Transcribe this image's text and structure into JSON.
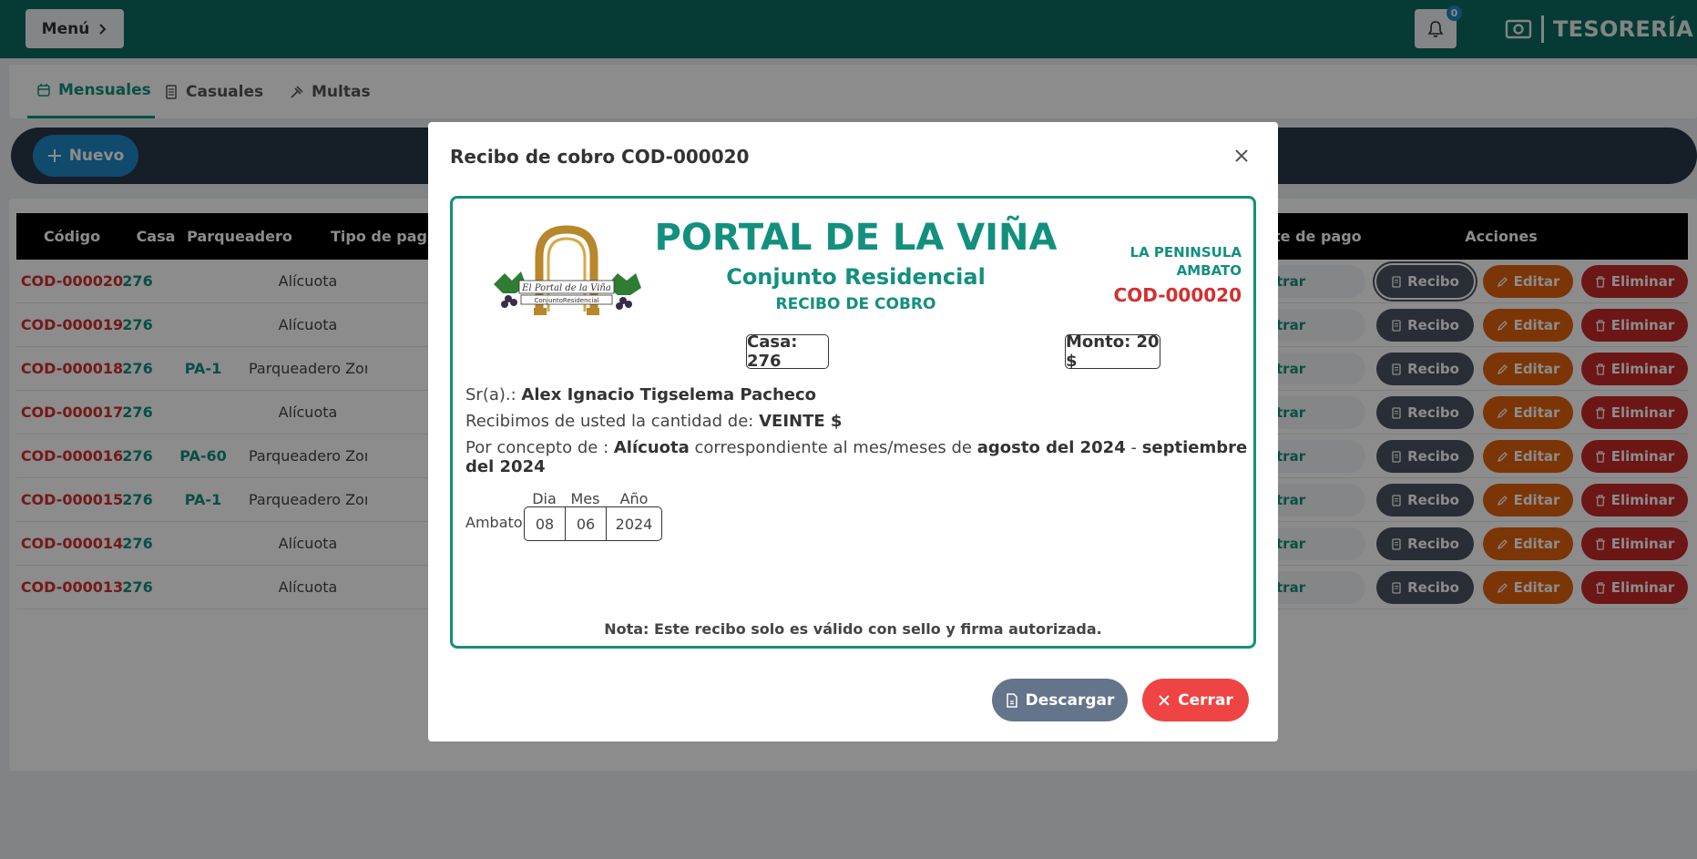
{
  "topbar": {
    "menu_label": "Menú",
    "notification_count": "0",
    "brand": "TESORERÍA"
  },
  "tabs": [
    {
      "label": "Mensuales",
      "icon": "calendar-icon"
    },
    {
      "label": "Casuales",
      "icon": "list-icon"
    },
    {
      "label": "Multas",
      "icon": "gavel-icon"
    }
  ],
  "toolbar": {
    "new_label": "Nuevo"
  },
  "table": {
    "headers": [
      "Código",
      "Casa",
      "Parqueadero",
      "Tipo de pago",
      "te de pago",
      "Acciones"
    ],
    "row_button_registrar": "trar",
    "actions": {
      "recibo": "Recibo",
      "editar": "Editar",
      "eliminar": "Eliminar"
    },
    "rows": [
      {
        "code": "COD-000020",
        "casa": "276",
        "parq": "",
        "tipo": "Alícuota"
      },
      {
        "code": "COD-000019",
        "casa": "276",
        "parq": "",
        "tipo": "Alícuota"
      },
      {
        "code": "COD-000018",
        "casa": "276",
        "parq": "PA-1",
        "tipo": "Parqueadero Zona"
      },
      {
        "code": "COD-000017",
        "casa": "276",
        "parq": "",
        "tipo": "Alícuota"
      },
      {
        "code": "COD-000016",
        "casa": "276",
        "parq": "PA-60",
        "tipo": "Parqueadero Zona"
      },
      {
        "code": "COD-000015",
        "casa": "276",
        "parq": "PA-1",
        "tipo": "Parqueadero Zona"
      },
      {
        "code": "COD-000014",
        "casa": "276",
        "parq": "",
        "tipo": "Alícuota"
      },
      {
        "code": "COD-000013",
        "casa": "276",
        "parq": "",
        "tipo": "Alícuota"
      }
    ]
  },
  "modal": {
    "title": "Recibo de cobro COD-000020",
    "receipt": {
      "logo_text_1": "El Portal de la Viña",
      "logo_text_2": "ConjuntoResidencial",
      "title": "PORTAL DE LA VIÑA",
      "subtitle": "Conjunto Residencial",
      "doc_type": "RECIBO DE COBRO",
      "location_1": "LA PENINSULA",
      "location_2": "AMBATO",
      "code": "COD-000020",
      "casa": "Casa: 276",
      "monto": "Monto: 20 $",
      "sr_label": "Sr(a).:",
      "sr_value": "Alex Ignacio Tigselema Pacheco",
      "amount_label": "Recibimos de usted la cantidad de:",
      "amount_value": "VEINTE $",
      "concept_label": "Por concepto de :",
      "concept_value": "Alícuota",
      "concept_mid": "correspondiente al mes/meses de",
      "period_from": "agosto del 2024",
      "period_sep": "-",
      "period_to": "septiembre del 2024",
      "city": "Ambato",
      "date_labels": {
        "day": "Dia",
        "month": "Mes",
        "year": "Año"
      },
      "date_values": {
        "day": "08",
        "month": "06",
        "year": "2024"
      },
      "note": "Nota: Este recibo solo es válido con sello y firma autorizada."
    },
    "download_label": "Descargar",
    "close_label": "Cerrar"
  },
  "colors": {
    "primary": "#0b6b5f",
    "accent": "#12907d",
    "danger": "#d32f2f",
    "info": "#1e88c7"
  }
}
